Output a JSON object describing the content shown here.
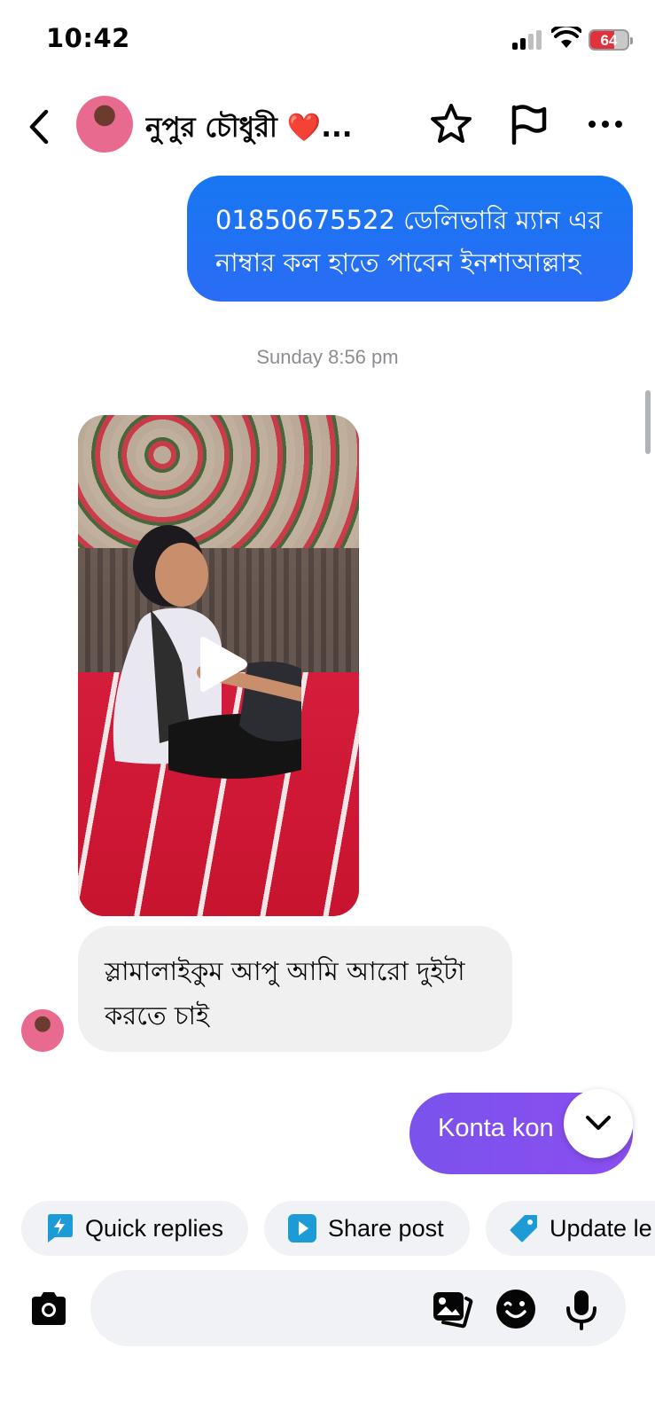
{
  "status_bar": {
    "time": "10:42",
    "battery_percent": "64"
  },
  "header": {
    "contact_name": "নুপুর চৌধুরী ❤️...",
    "icons": [
      "back-icon",
      "star-icon",
      "flag-icon",
      "more-icon"
    ]
  },
  "messages": {
    "outgoing_1": {
      "line1": "01850675522 ডেলিভারি ম্যান এর",
      "line2": "নাম্বার কল হাতে পাবেন ইনশাআল্লাহ"
    },
    "timestamp": "Sunday 8:56 pm",
    "incoming_1": {
      "line1": "স্লামালাইকুম আপু আমি আরো দুইটা",
      "line2": "করতে চাই"
    },
    "outgoing_2": "Konta kon"
  },
  "actions": {
    "quick_replies": "Quick replies",
    "share_post": "Share post",
    "update_lead": "Update le"
  },
  "composer": {
    "placeholder": ""
  },
  "colors": {
    "outgoing_blue": "#1877f2",
    "outgoing_purple": "#7b52ec",
    "incoming_gray": "#f0f0f0",
    "chip_bg": "#f0f2f5"
  }
}
